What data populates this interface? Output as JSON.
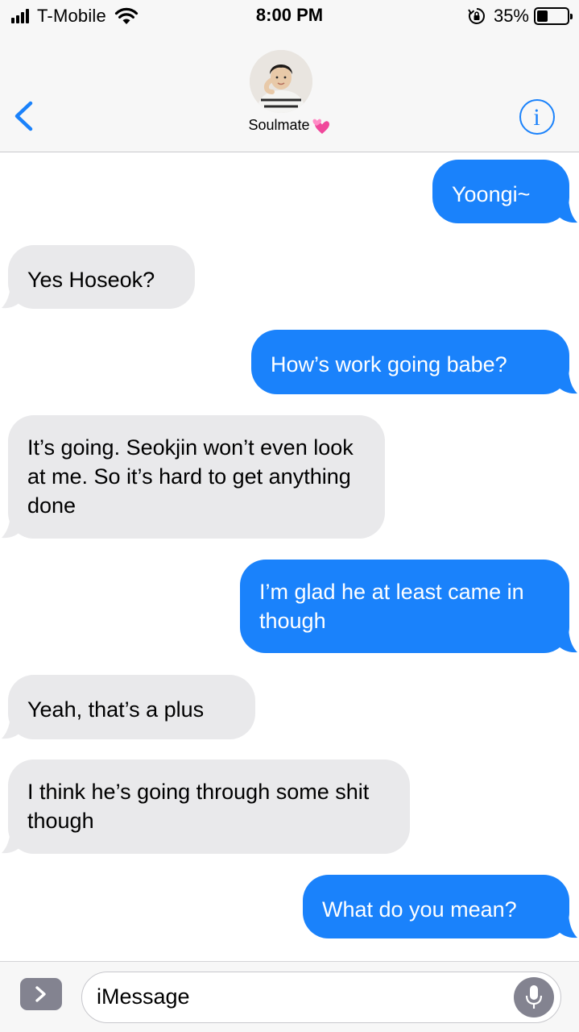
{
  "status_bar": {
    "carrier": "T-Mobile",
    "time": "8:00 PM",
    "battery_percent": "35%",
    "battery_level": 0.35,
    "icons": [
      "signal-bars-icon",
      "wifi-icon",
      "rotation-lock-icon",
      "battery-icon"
    ]
  },
  "header": {
    "contact_name": "Soulmate",
    "contact_emoji": "heart-emoji",
    "back_icon": "chevron-left-icon",
    "info_icon": "info-icon",
    "colors": {
      "accent": "#1a82fb"
    }
  },
  "messages": [
    {
      "side": "sent",
      "text": "Yoongi~"
    },
    {
      "side": "received",
      "text": "Yes Hoseok?"
    },
    {
      "side": "sent",
      "text": "How’s work going babe?"
    },
    {
      "side": "received",
      "text": "It’s going. Seokjin won’t even look at me. So it’s hard to get anything done"
    },
    {
      "side": "sent",
      "text": "I’m glad he at least came in though"
    },
    {
      "side": "received",
      "text": "Yeah, that’s a plus"
    },
    {
      "side": "received",
      "text": "I think he’s going through some shit though"
    },
    {
      "side": "sent",
      "text": "What do you mean?"
    }
  ],
  "colors": {
    "sent_bubble": "#1a82fb",
    "received_bubble": "#e9e9eb"
  },
  "input_bar": {
    "placeholder": "iMessage",
    "expand_icon": "chevron-right-icon",
    "mic_icon": "microphone-icon"
  }
}
